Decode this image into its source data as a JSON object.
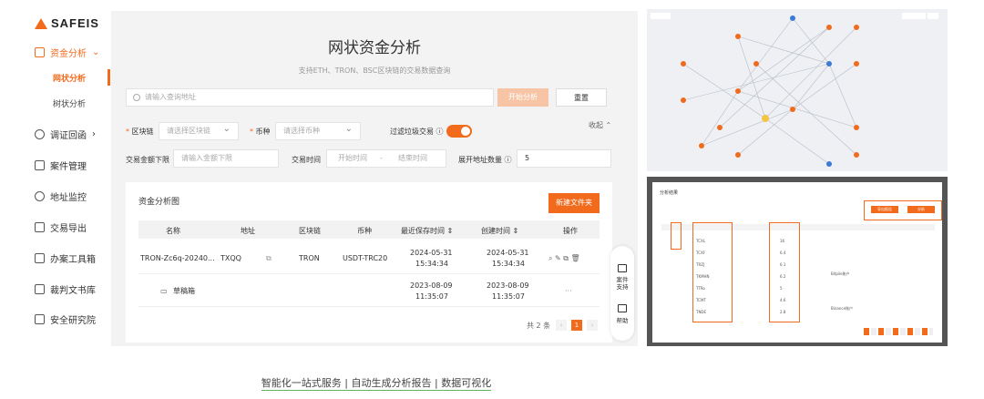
{
  "brand": {
    "name": "SAFEIS",
    "accent": "#f26b1d"
  },
  "sidebar": {
    "items": [
      {
        "label": "资金分析",
        "icon": "flow-icon",
        "active": true,
        "arrow": "⌄"
      },
      {
        "label": "调证回函",
        "icon": "people-icon",
        "arrow": "›"
      },
      {
        "label": "案件管理",
        "icon": "folder-icon"
      },
      {
        "label": "地址监控",
        "icon": "monitor-icon"
      },
      {
        "label": "交易导出",
        "icon": "export-icon"
      },
      {
        "label": "办案工具箱",
        "icon": "toolbox-icon"
      },
      {
        "label": "裁判文书库",
        "icon": "book-icon"
      },
      {
        "label": "安全研究院",
        "icon": "lab-icon"
      }
    ],
    "subitems": [
      "网状分析",
      "树状分析"
    ]
  },
  "main": {
    "title": "网状资金分析",
    "subtitle": "支持ETH、TRON、BSC区块链的交易数据查询",
    "search": {
      "placeholder": "请输入查询地址"
    },
    "search_button": "开始分析",
    "reset_button": "重置",
    "filters": {
      "chain_label": "区块链",
      "chain_placeholder": "请选择区块链",
      "coin_label": "币种",
      "coin_placeholder": "请选择币种",
      "junk_label": "过滤垃圾交易",
      "collapse": "收起 ⌃",
      "amount_label": "交易金额下限",
      "amount_placeholder": "请输入金额下限",
      "time_label": "交易时间",
      "time_start": "开始时间",
      "time_sep": "-",
      "time_end": "结束时间",
      "expand_label": "展开地址数量",
      "expand_value": "5"
    },
    "card": {
      "title": "资金分析图",
      "new_folder": "新建文件夹",
      "columns": [
        "名称",
        "地址",
        "区块链",
        "币种",
        "最近保存时间 ⇕",
        "创建时间 ⇕",
        "操作"
      ],
      "rows": [
        {
          "name": "TRON-Zc6q-20240...",
          "address": "TXQQ",
          "chain": "TRON",
          "coin": "USDT-TRC20",
          "saved_date": "2024-05-31",
          "saved_time": "15:34:34",
          "created_date": "2024-05-31",
          "created_time": "15:34:34",
          "actions": "⌕ ✎ ⧉ 🗑"
        },
        {
          "name": "草稿箱",
          "saved_date": "2023-08-09",
          "saved_time": "11:35:07",
          "created_date": "2023-08-09",
          "created_time": "11:35:07",
          "actions": "···"
        }
      ],
      "total": "共 2 条",
      "page": "1"
    },
    "float": {
      "case_support": "案件支持",
      "help": "帮助"
    }
  },
  "caption": "智能化一站式服务 | 自动生成分析报告 | 数据可视化",
  "analysis_panel": {
    "title": "分析结果",
    "buttons": [
      "导出报告",
      "分析"
    ],
    "rows": [
      "TCXL",
      "TCXF",
      "TRZJ",
      "TKMHN",
      "TTRo",
      "TCMT",
      "TNDE"
    ],
    "values": [
      "16",
      "6.4",
      "6.1",
      "6.2",
      "5",
      "4.6",
      "2.8"
    ],
    "notes": [
      "Bitpile账户",
      "Binance账户"
    ]
  }
}
